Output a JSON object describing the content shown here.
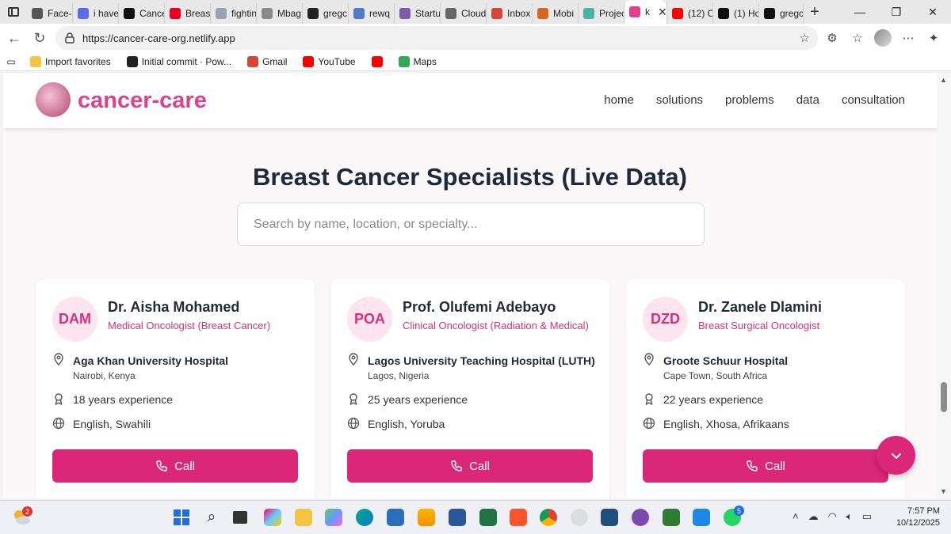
{
  "browser": {
    "tabs": [
      {
        "label": "Face-",
        "color": "#555555"
      },
      {
        "label": "i have",
        "color": "#5b6ee1"
      },
      {
        "label": "Cance",
        "color": "#111111"
      },
      {
        "label": "Breas",
        "color": "#e60023"
      },
      {
        "label": "fightin",
        "color": "#9aa3b5"
      },
      {
        "label": "Mbag",
        "color": "#8a8a8a"
      },
      {
        "label": "gregc",
        "color": "#222222"
      },
      {
        "label": "rewq",
        "color": "#4f7cc2"
      },
      {
        "label": "Startu",
        "color": "#7b5ea7"
      },
      {
        "label": "Cloud",
        "color": "#666666"
      },
      {
        "label": "Inbox",
        "color": "#d44638"
      },
      {
        "label": "Mobi",
        "color": "#d2691e"
      },
      {
        "label": "Projec",
        "color": "#4bb3a0"
      },
      {
        "label": "k",
        "color": "#e0418b"
      },
      {
        "label": "(12) C",
        "color": "#ff0000"
      },
      {
        "label": "(1) Ho",
        "color": "#111111"
      },
      {
        "label": "gregc",
        "color": "#111111"
      }
    ],
    "url": "https://cancer-care-org.netlify.app",
    "favorites": [
      {
        "label": "Import favorites",
        "icon": "folder-icon"
      },
      {
        "label": "Initial commit · Pow...",
        "icon": "github-icon"
      },
      {
        "label": "Gmail",
        "icon": "gmail-icon"
      },
      {
        "label": "YouTube",
        "icon": "youtube-icon"
      },
      {
        "label": "",
        "icon": "youtube-icon"
      },
      {
        "label": "Maps",
        "icon": "maps-pin-icon"
      }
    ]
  },
  "site": {
    "brand": "cancer-care",
    "brand_color": "#e0418b",
    "nav": [
      "home",
      "solutions",
      "problems",
      "data",
      "consultation"
    ],
    "title": "Breast Cancer Specialists (Live Data)",
    "search_placeholder": "Search by name, location, or specialty...",
    "accent": "#db2777",
    "doctors": [
      {
        "initials": "DAM",
        "name": "Dr. Aisha Mohamed",
        "specialty": "Medical Oncologist (Breast Cancer)",
        "hospital": "Aga Khan University Hospital",
        "city": "Nairobi, Kenya",
        "experience": "18 years experience",
        "languages": "English, Swahili",
        "call": "Call"
      },
      {
        "initials": "POA",
        "name": "Prof. Olufemi Adebayo",
        "specialty": "Clinical Oncologist (Radiation & Medical)",
        "hospital": "Lagos University Teaching Hospital (LUTH)",
        "city": "Lagos, Nigeria",
        "experience": "25 years experience",
        "languages": "English, Yoruba",
        "call": "Call"
      },
      {
        "initials": "DZD",
        "name": "Dr. Zanele Dlamini",
        "specialty": "Breast Surgical Oncologist",
        "hospital": "Groote Schuur Hospital",
        "city": "Cape Town, South Africa",
        "experience": "22 years experience",
        "languages": "English, Xhosa, Afrikaans",
        "call": "Call"
      }
    ]
  },
  "taskbar": {
    "weather_badge": "2",
    "whatsapp_badge": "5",
    "time": "7:57 PM",
    "date": "10/12/2025"
  }
}
